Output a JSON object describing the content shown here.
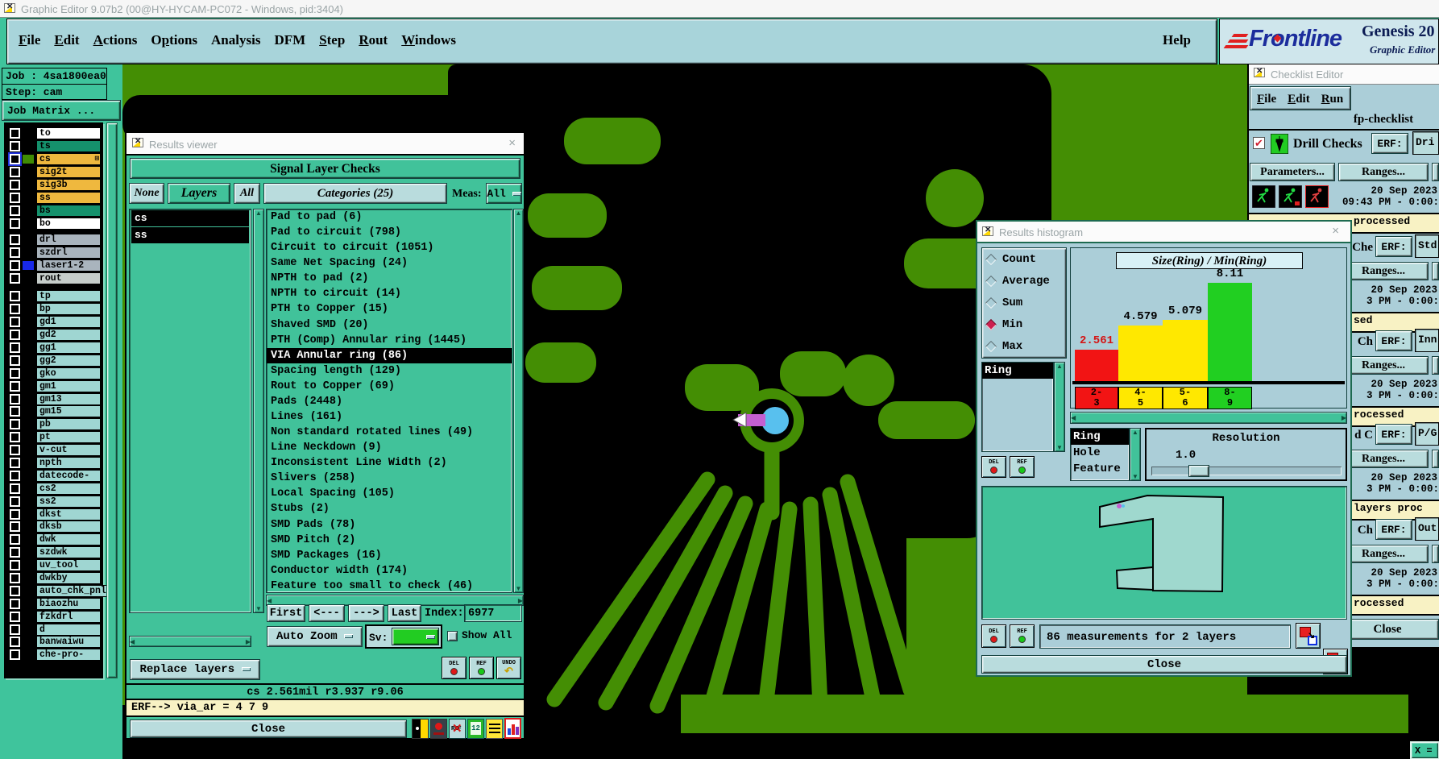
{
  "window": {
    "title": "Graphic Editor 9.07b2 (00@HY-HYCAM-PC072 - Windows, pid:3404)"
  },
  "menubar": {
    "items": [
      {
        "label": "File",
        "u": 0
      },
      {
        "label": "Edit",
        "u": 0
      },
      {
        "label": "Actions",
        "u": 0
      },
      {
        "label": "Options",
        "u": 1
      },
      {
        "label": "Analysis",
        "u": -1
      },
      {
        "label": "DFM",
        "u": -1
      },
      {
        "label": "Step",
        "u": 0
      },
      {
        "label": "Rout",
        "u": 0
      },
      {
        "label": "Windows",
        "u": 0
      }
    ],
    "help_label": "Help"
  },
  "brand": {
    "name_left": "Fr",
    "name_o": "o",
    "name_right": "ntline",
    "product": "Genesis 20",
    "subtitle": "Graphic Editor"
  },
  "sidebar": {
    "job_label": "Job : 4sa1800ea0",
    "step_label": "Step: cam",
    "job_matrix_label": "Job Matrix ...",
    "groups": [
      {
        "rows": [
          {
            "name": "to",
            "bg": "#ffffff",
            "cb": "normal",
            "swatch": null,
            "grid": false
          },
          {
            "name": "ts",
            "bg": "#15916c",
            "cb": "normal",
            "swatch": null,
            "grid": false
          },
          {
            "name": "cs",
            "bg": "#efb83e",
            "cb": "active",
            "swatch": "#3f8c04",
            "grid": true
          },
          {
            "name": "sig2t",
            "bg": "#efb83e",
            "cb": "normal",
            "swatch": null,
            "grid": false
          },
          {
            "name": "sig3b",
            "bg": "#efb83e",
            "cb": "normal",
            "swatch": null,
            "grid": false
          },
          {
            "name": "ss",
            "bg": "#efb83e",
            "cb": "normal",
            "swatch": null,
            "grid": false
          },
          {
            "name": "bs",
            "bg": "#15916c",
            "cb": "normal",
            "swatch": null,
            "grid": false
          },
          {
            "name": "bo",
            "bg": "#ffffff",
            "cb": "normal",
            "swatch": null,
            "grid": false
          }
        ]
      },
      {
        "rows": [
          {
            "name": "drl",
            "bg": "#a9b4bd",
            "cb": "normal",
            "swatch": null,
            "grid": false
          },
          {
            "name": "szdrl",
            "bg": "#a9b4bd",
            "cb": "normal",
            "swatch": null,
            "grid": false
          },
          {
            "name": "laser1-2",
            "bg": "#a9b4bd",
            "cb": "normal",
            "swatch": "#1828e8",
            "grid": false
          },
          {
            "name": "rout",
            "bg": "#c6cdca",
            "cb": "normal",
            "swatch": null,
            "grid": false
          }
        ]
      },
      {
        "rows": [
          {
            "name": "tp",
            "bg": "#9fd6d2",
            "cb": "normal",
            "swatch": null,
            "grid": false
          },
          {
            "name": "bp",
            "bg": "#9fd6d2",
            "cb": "normal",
            "swatch": null,
            "grid": false
          },
          {
            "name": "gd1",
            "bg": "#9fd6d2",
            "cb": "normal",
            "swatch": null,
            "grid": false
          },
          {
            "name": "gd2",
            "bg": "#9fd6d2",
            "cb": "normal",
            "swatch": null,
            "grid": false
          },
          {
            "name": "gg1",
            "bg": "#9fd6d2",
            "cb": "normal",
            "swatch": null,
            "grid": false
          },
          {
            "name": "gg2",
            "bg": "#9fd6d2",
            "cb": "normal",
            "swatch": null,
            "grid": false
          },
          {
            "name": "gko",
            "bg": "#9fd6d2",
            "cb": "normal",
            "swatch": null,
            "grid": false
          },
          {
            "name": "gm1",
            "bg": "#9fd6d2",
            "cb": "normal",
            "swatch": null,
            "grid": false
          },
          {
            "name": "gm13",
            "bg": "#9fd6d2",
            "cb": "normal",
            "swatch": null,
            "grid": false
          },
          {
            "name": "gm15",
            "bg": "#9fd6d2",
            "cb": "normal",
            "swatch": null,
            "grid": false
          },
          {
            "name": "pb",
            "bg": "#9fd6d2",
            "cb": "normal",
            "swatch": null,
            "grid": false
          },
          {
            "name": "pt",
            "bg": "#9fd6d2",
            "cb": "normal",
            "swatch": null,
            "grid": false
          },
          {
            "name": "v-cut",
            "bg": "#9fd6d2",
            "cb": "normal",
            "swatch": null,
            "grid": false
          },
          {
            "name": "npth",
            "bg": "#9fd6d2",
            "cb": "normal",
            "swatch": null,
            "grid": false
          },
          {
            "name": "datecode-pt",
            "bg": "#9fd6d2",
            "cb": "normal",
            "swatch": null,
            "grid": false
          },
          {
            "name": "cs2",
            "bg": "#9fd6d2",
            "cb": "normal",
            "swatch": null,
            "grid": false
          },
          {
            "name": "ss2",
            "bg": "#9fd6d2",
            "cb": "normal",
            "swatch": null,
            "grid": false
          },
          {
            "name": "dkst",
            "bg": "#9fd6d2",
            "cb": "normal",
            "swatch": null,
            "grid": false
          },
          {
            "name": "dksb",
            "bg": "#9fd6d2",
            "cb": "normal",
            "swatch": null,
            "grid": false
          },
          {
            "name": "dwk",
            "bg": "#9fd6d2",
            "cb": "normal",
            "swatch": null,
            "grid": false
          },
          {
            "name": "szdwk",
            "bg": "#9fd6d2",
            "cb": "normal",
            "swatch": null,
            "grid": false
          },
          {
            "name": "uv_tool",
            "bg": "#9fd6d2",
            "cb": "normal",
            "swatch": null,
            "grid": false
          },
          {
            "name": "dwkby",
            "bg": "#9fd6d2",
            "cb": "normal",
            "swatch": null,
            "grid": false
          },
          {
            "name": "auto_chk_pnl",
            "bg": "#9fd6d2",
            "cb": "normal",
            "swatch": null,
            "grid": false
          },
          {
            "name": "biaozhu",
            "bg": "#9fd6d2",
            "cb": "normal",
            "swatch": null,
            "grid": false
          },
          {
            "name": "fzkdrl",
            "bg": "#9fd6d2",
            "cb": "normal",
            "swatch": null,
            "grid": false
          },
          {
            "name": "d",
            "bg": "#9fd6d2",
            "cb": "normal",
            "swatch": null,
            "grid": false
          },
          {
            "name": "banwaiwu",
            "bg": "#9fd6d2",
            "cb": "normal",
            "swatch": null,
            "grid": false
          },
          {
            "name": "che-pro-out",
            "bg": "#9fd6d2",
            "cb": "normal",
            "swatch": null,
            "grid": false
          }
        ]
      }
    ]
  },
  "results_viewer": {
    "title": "Results viewer",
    "header": "Signal Layer Checks",
    "none_label": "None",
    "layers_label": "Layers",
    "all_label": "All",
    "categories_header": "Categories (25)",
    "meas_label": "Meas:",
    "meas_value": "All",
    "layers": [
      "cs",
      "ss"
    ],
    "categories": [
      "Pad to pad (6)",
      "Pad to circuit (798)",
      "Circuit to circuit (1051)",
      "Same Net Spacing (24)",
      "NPTH to pad (2)",
      "NPTH to circuit (14)",
      "PTH to Copper (15)",
      "Shaved SMD (20)",
      "PTH (Comp) Annular ring (1445)",
      "VIA Annular ring (86)",
      "Spacing length (129)",
      "Rout to Copper (69)",
      "Pads (2448)",
      "Lines (161)",
      "Non standard rotated lines (49)",
      "Line Neckdown (9)",
      "Inconsistent Line Width (2)",
      "Slivers (258)",
      "Local Spacing (105)",
      "Stubs (2)",
      "SMD Pads (78)",
      "SMD Pitch (2)",
      "SMD Packages (16)",
      "Conductor width (174)",
      "Feature too small to check (46)"
    ],
    "selected_category": "VIA Annular ring (86)",
    "nav": {
      "first": "First",
      "prev": "<---",
      "next": "--->",
      "last": "Last",
      "index_label": "Index:",
      "index_value": "6977"
    },
    "auto_zoom_label": "Auto Zoom",
    "sv_label": "Sv:",
    "show_all_label": "Show All",
    "replace_layers_label": "Replace layers",
    "del_label": "DEL",
    "ref_label": "REF",
    "undo_label": "UNDO",
    "status_line": "cs 2.561mil  r3.937  r9.06",
    "erf_line": "ERF--> via_ar = 4 7 9",
    "close_label": "Close"
  },
  "histogram": {
    "title": "Results histogram",
    "stats": [
      {
        "label": "Count",
        "selected": false
      },
      {
        "label": "Average",
        "selected": false
      },
      {
        "label": "Sum",
        "selected": false
      },
      {
        "label": "Min",
        "selected": true
      },
      {
        "label": "Max",
        "selected": false
      }
    ],
    "layer_list": [
      "Ring"
    ],
    "measure_list": [
      "Ring",
      "Hole",
      "Feature"
    ],
    "selected_measure": "Ring",
    "resolution_label": "Resolution",
    "resolution_value": "1.0",
    "del_label": "DEL",
    "ref_label": "REF",
    "footer_text": "86 measurements for 2 layers",
    "close_label": "Close"
  },
  "chart_data": {
    "type": "bar",
    "title": "Size(Ring) / Min(Ring)",
    "categories": [
      "2-3",
      "4-5",
      "5-6",
      "8-9"
    ],
    "values": [
      2.561,
      4.579,
      5.079,
      8.11
    ],
    "value_labels": [
      "2.561",
      "4.579",
      "5.079",
      "8.11"
    ],
    "bar_colors": [
      "#f21414",
      "#ffe800",
      "#ffe800",
      "#21cf21"
    ],
    "value_label_colors": [
      "#d41414",
      "#000000",
      "#000000",
      "#000000"
    ],
    "ylim": [
      0,
      8.8
    ],
    "xlabel": "",
    "ylabel": "",
    "legend": false
  },
  "checklist": {
    "title": "Checklist Editor",
    "menu": [
      {
        "label": "File",
        "u": 0
      },
      {
        "label": "Edit",
        "u": 0
      },
      {
        "label": "Run",
        "u": 0
      }
    ],
    "name": "fp-checklist",
    "first_section": {
      "label": "Drill Checks",
      "erf_label": "ERF:",
      "erf_value": "Dri",
      "parameters_label": "Parameters...",
      "ranges_label": "Ranges...",
      "date_line1": "20 Sep 2023",
      "date_line2": "09:43 PM - 0:00:",
      "status": "processed"
    },
    "sections": [
      {
        "label": "Che",
        "erf_label": "ERF:",
        "erf_value": "Std",
        "ranges_label": "Ranges...",
        "date_line1": "20 Sep 2023",
        "date_line2": "3 PM - 0:00:",
        "status": "sed"
      },
      {
        "label": "Ch",
        "erf_label": "ERF:",
        "erf_value": "Inn",
        "ranges_label": "Ranges...",
        "date_line1": "20 Sep 2023",
        "date_line2": "3 PM - 0:00:",
        "status": "rocessed"
      },
      {
        "label": "d C",
        "erf_label": "ERF:",
        "erf_value": "P/G",
        "ranges_label": "Ranges...",
        "date_line1": "20 Sep 2023",
        "date_line2": "3 PM - 0:00:",
        "status": "layers proc"
      },
      {
        "label": "Ch",
        "erf_label": "ERF:",
        "erf_value": "Out",
        "ranges_label": "Ranges...",
        "date_line1": "20 Sep 2023",
        "date_line2": "3 PM - 0:00:",
        "status": "rocessed"
      }
    ],
    "close_label": "Close"
  },
  "mini_window": {
    "label": "X ="
  },
  "icons": {
    "close": "×",
    "check": "✔",
    "grid": "⊞",
    "undo": "↶",
    "scroll_up": "▲",
    "scroll_down": "▼",
    "scroll_left": "◀",
    "scroll_right": "▶"
  },
  "colors": {
    "pcb_green": "#448e04",
    "via_hole_cyan": "#58c0ee",
    "measure_magenta": "#c45fd0",
    "measure_red": "#e02020",
    "desktop_teal": "#3fc49c",
    "panel_blue": "#abced8",
    "button_face": "#b9dcdd",
    "status_cream": "#f8f2c4",
    "sv_green": "#22cc22",
    "bar_red": "#f21414",
    "bar_yellow": "#ffe800",
    "bar_green": "#21cf21"
  }
}
